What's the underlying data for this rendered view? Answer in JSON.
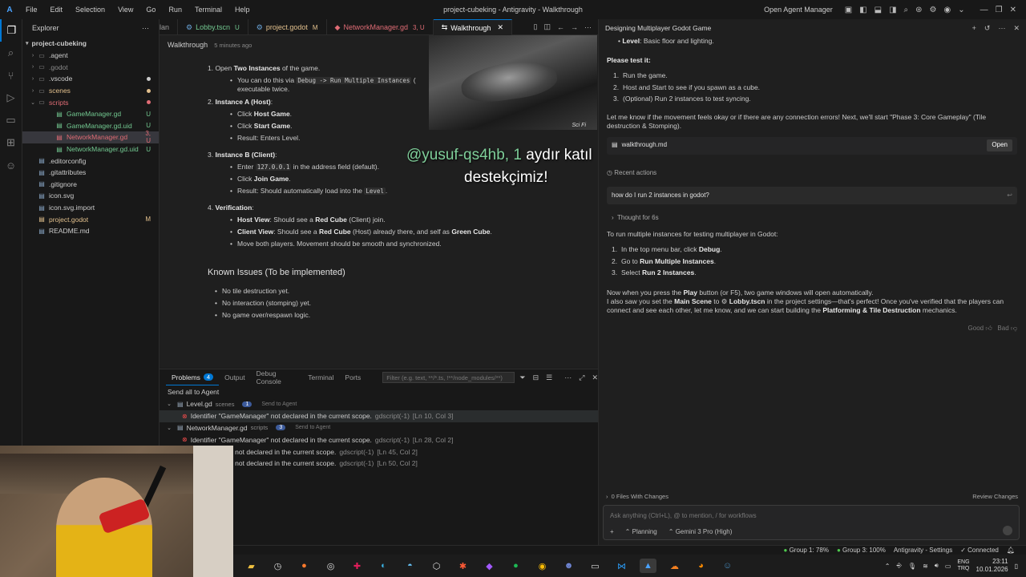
{
  "window": {
    "logo": "A",
    "menu": [
      "File",
      "Edit",
      "Selection",
      "View",
      "Go",
      "Run",
      "Terminal",
      "Help"
    ],
    "title": "project-cubeking - Antigravity - Walkthrough",
    "open_agent_manager": "Open Agent Manager"
  },
  "explorer": {
    "header": "Explorer",
    "project": "project-cubeking",
    "items": [
      {
        "name": ".agent",
        "type": "folder",
        "status": "",
        "color": "#cccccc"
      },
      {
        "name": ".godot",
        "type": "folder",
        "status": "",
        "color": "#8b8b8b"
      },
      {
        "name": ".vscode",
        "type": "folder",
        "status": "dot",
        "color": "#cccccc"
      },
      {
        "name": "scenes",
        "type": "folder",
        "status": "dot",
        "color": "#e2c08d"
      },
      {
        "name": "scripts",
        "type": "folder-open",
        "status": "dot",
        "color": "#e06c75"
      },
      {
        "name": "GameManager.gd",
        "type": "file",
        "status": "U",
        "color": "#73c991"
      },
      {
        "name": "GameManager.gd.uid",
        "type": "file",
        "status": "U",
        "color": "#73c991"
      },
      {
        "name": "NetworkManager.gd",
        "type": "file",
        "status": "3, U",
        "color": "#e06c75"
      },
      {
        "name": "NetworkManager.gd.uid",
        "type": "file",
        "status": "U",
        "color": "#73c991"
      },
      {
        "name": ".editorconfig",
        "type": "file",
        "status": "",
        "color": "#cccccc"
      },
      {
        "name": ".gitattributes",
        "type": "file",
        "status": "",
        "color": "#cccccc"
      },
      {
        "name": ".gitignore",
        "type": "file",
        "status": "",
        "color": "#cccccc"
      },
      {
        "name": "icon.svg",
        "type": "file",
        "status": "",
        "color": "#cccccc"
      },
      {
        "name": "icon.svg.import",
        "type": "file",
        "status": "",
        "color": "#cccccc"
      },
      {
        "name": "project.godot",
        "type": "file",
        "status": "M",
        "color": "#e2c08d"
      },
      {
        "name": "README.md",
        "type": "file",
        "status": "",
        "color": "#cccccc"
      }
    ]
  },
  "tabs": [
    {
      "label": "lan",
      "badge": "",
      "color": "#9d9d9d"
    },
    {
      "label": "Lobby.tscn",
      "badge": "U",
      "color": "#73c991"
    },
    {
      "label": "project.godot",
      "badge": "M",
      "color": "#e2c08d"
    },
    {
      "label": "NetworkManager.gd",
      "badge": "3, U",
      "color": "#e06c75"
    },
    {
      "label": "Walkthrough",
      "badge": "",
      "color": "#ffffff"
    }
  ],
  "editor": {
    "doc_title": "Walkthrough",
    "updated": "5 minutes ago",
    "step1": {
      "num": "1. Open",
      "bold": "Two Instances",
      "rest": "of the game."
    },
    "step1_b1": {
      "pre": "You can do this via",
      "code": "Debug -> Run Multiple Instances",
      "post": "(",
      "line2": "executable twice."
    },
    "step2": {
      "num": "2.",
      "bold": "Instance A (Host)",
      "rest": ":"
    },
    "step2_items": [
      {
        "pre": "Click",
        "bold": "Host Game",
        "post": "."
      },
      {
        "pre": "Click",
        "bold": "Start Game",
        "post": "."
      },
      {
        "pre": "Result: Enters Level.",
        "bold": "",
        "post": ""
      }
    ],
    "step3": {
      "num": "3.",
      "bold": "Instance B (Client)",
      "rest": ":"
    },
    "step3_b1": {
      "pre": "Enter",
      "code": "127.0.0.1",
      "post": "in the address field (default)."
    },
    "step3_b2": {
      "pre": "Click",
      "bold": "Join Game",
      "post": "."
    },
    "step3_b3": {
      "pre": "Result: Should automatically load into the",
      "code": "Level",
      "post": "."
    },
    "step4": {
      "num": "4.",
      "bold": "Verification",
      "rest": ":"
    },
    "step4_b1": {
      "bold": "Host View",
      "a": ": Should see a",
      "b": "Red Cube",
      "c": "(Client) join."
    },
    "step4_b2": {
      "bold": "Client View",
      "a": ": Should see a",
      "b": "Red Cube",
      "c": "(Host) already there, and self as",
      "d": "Green Cube",
      "e": "."
    },
    "step4_b3": "Move both players. Movement should be smooth and synchronized.",
    "known_title": "Known Issues (To be implemented)",
    "known_items": [
      "No tile destruction yet.",
      "No interaction (stomping) yet.",
      "No game over/respawn logic."
    ]
  },
  "video": {
    "watermark": "Sci Fi"
  },
  "overlay": {
    "user": "@yusuf-qs4hb",
    "count": ", 1",
    "text1": "aydır katıl",
    "text2": "destekçimiz!"
  },
  "panel": {
    "tabs": [
      "Problems",
      "Output",
      "Debug Console",
      "Terminal",
      "Ports"
    ],
    "problems_count": "4",
    "filter_placeholder": "Filter (e.g. text, **/*.ts, !**/node_modules/**)",
    "send_all": "Send all to Agent",
    "groups": [
      {
        "file": "Level.gd",
        "dir": "scenes",
        "count": "1",
        "send": "Send to Agent",
        "errors": [
          {
            "msg": "Identifier \"GameManager\" not declared in the current scope.",
            "src": "gdscript(-1)",
            "pos": "[Ln 10, Col 3]"
          }
        ]
      },
      {
        "file": "NetworkManager.gd",
        "dir": "scripts",
        "count": "3",
        "send": "Send to Agent",
        "errors": [
          {
            "msg": "Identifier \"GameManager\" not declared in the current scope.",
            "src": "gdscript(-1)",
            "pos": "[Ln 28, Col 2]"
          },
          {
            "msg": "ameManager\" not declared in the current scope.",
            "src": "gdscript(-1)",
            "pos": "[Ln 45, Col 2]"
          },
          {
            "msg": "ameManager\" not declared in the current scope.",
            "src": "gdscript(-1)",
            "pos": "[Ln 50, Col 2]"
          }
        ]
      }
    ]
  },
  "agent": {
    "title": "Designing Multiplayer Godot Game",
    "level_line": {
      "bold": "Level",
      "rest": ": Basic floor and lighting."
    },
    "please_test": "Please test it:",
    "test_steps": [
      "Run the game.",
      "Host and Start to see if you spawn as a cube.",
      "(Optional) Run 2 instances to test syncing."
    ],
    "let_me_know": "Let me know if the movement feels okay or if there are any connection errors! Next, we'll start \"Phase 3: Core Gameplay\" (Tile destruction & Stomping).",
    "artifact_name": "walkthrough.md",
    "open_btn": "Open",
    "recent_actions": "Recent actions",
    "user_question": "how do I run 2 instances in godot?",
    "thought": "Thought for 6s",
    "answer_intro": "To run multiple instances for testing multiplayer in Godot:",
    "answer_steps": [
      {
        "pre": "In the top menu bar, click",
        "bold": "Debug",
        "post": "."
      },
      {
        "pre": "Go to",
        "bold": "Run Multiple Instances",
        "post": "."
      },
      {
        "pre": "Select",
        "bold": "Run 2 Instances",
        "post": "."
      }
    ],
    "now_when": {
      "pre": "Now when you press the",
      "bold": "Play",
      "post": "button (or F5), two game windows will open automatically."
    },
    "also_saw": {
      "pre": "I also saw you set the",
      "bold": "Main Scene",
      "mid": "to",
      "file": "Lobby.tscn",
      "post": "in the project settings—that's perfect! Once you've verified that the players can connect and see each other, let me know, and we can start building the",
      "bold2": "Platforming & Tile Destruction",
      "end": "mechanics."
    },
    "feedback": {
      "good": "Good",
      "bad": "Bad"
    },
    "files_changed": "0 Files With Changes",
    "review": "Review Changes",
    "input_placeholder": "Ask anything (Ctrl+L), @ to mention, / for workflows",
    "mode": "Planning",
    "model": "Gemini 3 Pro (High)"
  },
  "status": {
    "group1": "Group 1: 78%",
    "group3": "Group 3: 100%",
    "settings": "Antigravity - Settings",
    "connected": "Connected"
  },
  "taskbar": {
    "lang1": "ENG",
    "lang2": "TRQ",
    "time": "23:11",
    "date": "10.01.2026"
  }
}
